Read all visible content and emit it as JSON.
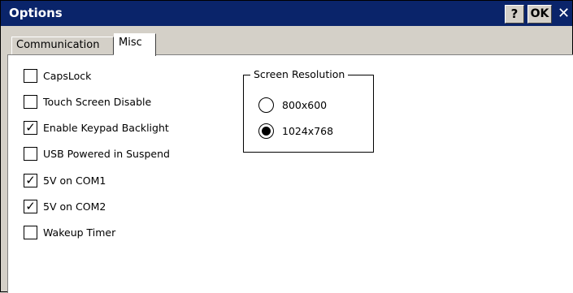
{
  "window": {
    "title": "Options",
    "help_label": "?",
    "ok_label": "OK",
    "close_label": "✕"
  },
  "tabs": [
    {
      "label": "Communication",
      "active": false
    },
    {
      "label": "Misc",
      "active": true
    }
  ],
  "checkboxes": [
    {
      "label": "CapsLock",
      "checked": false
    },
    {
      "label": "Touch Screen Disable",
      "checked": false
    },
    {
      "label": "Enable Keypad Backlight",
      "checked": true
    },
    {
      "label": "USB Powered in Suspend",
      "checked": false
    },
    {
      "label": "5V on COM1",
      "checked": true
    },
    {
      "label": "5V on COM2",
      "checked": true
    },
    {
      "label": "Wakeup Timer",
      "checked": false
    }
  ],
  "screen_resolution": {
    "legend": "Screen Resolution",
    "options": [
      {
        "label": "800x600",
        "selected": false
      },
      {
        "label": "1024x768",
        "selected": true
      }
    ]
  },
  "check_glyph": "✓",
  "colors": {
    "titlebar": "#0a246a",
    "face": "#d4d0c8",
    "panel": "#ffffff"
  }
}
